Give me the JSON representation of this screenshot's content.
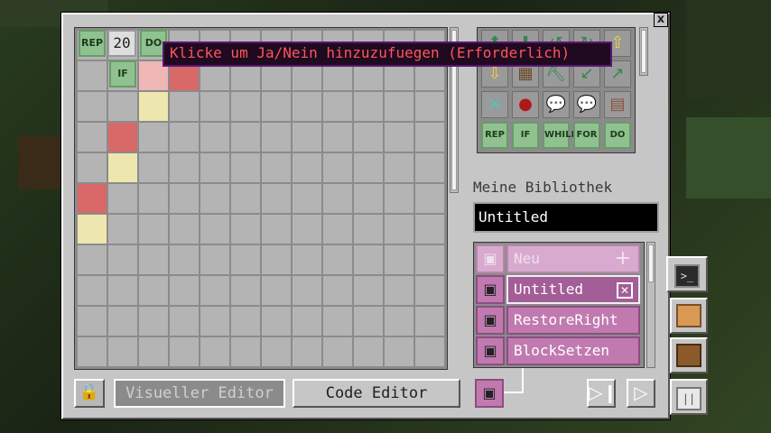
{
  "window": {
    "close_label": "x"
  },
  "tooltip": {
    "text": "Klicke um Ja/Nein hinzuzufuegen (Erforderlich)"
  },
  "grid": {
    "cols": 12,
    "rows": 11,
    "blocks": {
      "rep": "REP",
      "count": "20",
      "do": "DO",
      "if": "IF"
    },
    "cell_colors": {
      "red": "#d96868",
      "yellow": "#ede6ae",
      "pink": "#efb6b6",
      "empty": "#b4b4b4"
    }
  },
  "palette": {
    "rows": [
      [
        "arrow-up-icon",
        "arrow-down-icon",
        "rotate-left-icon",
        "rotate-right-icon",
        "arrow-up-yellow-icon"
      ],
      [
        "arrow-down-yellow-icon",
        "wood-block-icon",
        "pickaxe-icon",
        "arrow-down-left-icon",
        "arrow-up-right-icon"
      ],
      [
        "sword-icon",
        "redstone-icon",
        "speech-bubble-icon",
        "speech-bubble-yellow-icon",
        "brick-block-icon"
      ]
    ],
    "logic_blocks": [
      "REP",
      "IF",
      "WHILE",
      "FOR",
      "DO"
    ]
  },
  "library": {
    "title": "Meine Bibliothek",
    "name_value": "Untitled",
    "items": [
      {
        "label": "Neu",
        "icon": "floppy-icon",
        "kind": "new"
      },
      {
        "label": "Untitled",
        "icon": "floppy-icon",
        "kind": "selected"
      },
      {
        "label": "RestoreRight",
        "icon": "floppy-icon",
        "kind": "normal"
      },
      {
        "label": "BlockSetzen",
        "icon": "floppy-icon",
        "kind": "normal"
      }
    ]
  },
  "bottom": {
    "visual_editor_label": "Visueller Editor",
    "code_editor_label": "Code Editor"
  },
  "colors": {
    "accent_pink": "#c07ab0",
    "tooltip_text": "#ff5656",
    "logic_green": "#8fc28f"
  }
}
